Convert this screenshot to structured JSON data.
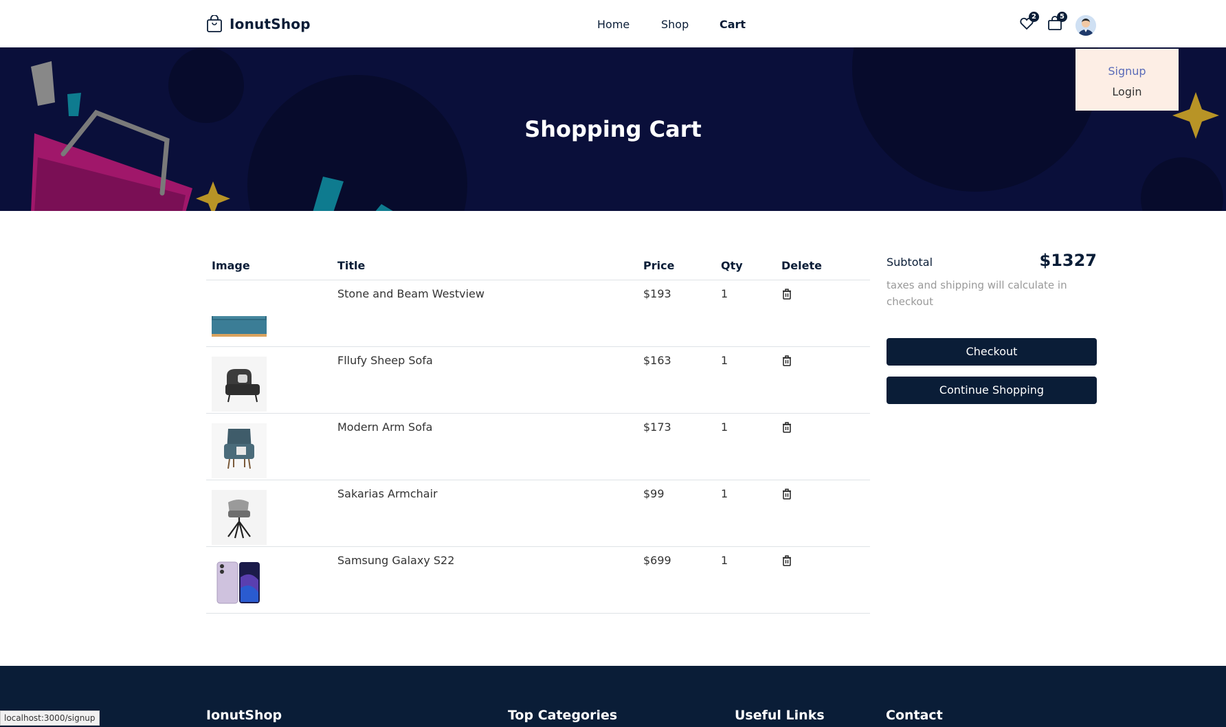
{
  "header": {
    "brand": "IonutShop",
    "nav": [
      {
        "label": "Home"
      },
      {
        "label": "Shop"
      },
      {
        "label": "Cart"
      }
    ],
    "wishlist_count": "2",
    "cart_count": "5"
  },
  "dropdown": {
    "signup": "Signup",
    "login": "Login"
  },
  "hero": {
    "title": "Shopping Cart"
  },
  "table": {
    "headers": {
      "image": "Image",
      "title": "Title",
      "price": "Price",
      "qty": "Qty",
      "delete": "Delete"
    },
    "rows": [
      {
        "title": "Stone and Beam Westview",
        "price": "$193",
        "qty": "1"
      },
      {
        "title": "Fllufy Sheep Sofa",
        "price": "$163",
        "qty": "1"
      },
      {
        "title": "Modern Arm Sofa",
        "price": "$173",
        "qty": "1"
      },
      {
        "title": "Sakarias Armchair",
        "price": "$99",
        "qty": "1"
      },
      {
        "title": "Samsung Galaxy S22",
        "price": "$699",
        "qty": "1"
      }
    ]
  },
  "summary": {
    "subtotal_label": "Subtotal",
    "subtotal_value": "$1327",
    "note": "taxes and shipping will calculate in checkout",
    "checkout": "Checkout",
    "continue": "Continue Shopping"
  },
  "footer": {
    "brand": "IonutShop",
    "top_categories": "Top Categories",
    "useful_links": "Useful Links",
    "contact": "Contact"
  },
  "status_bar": "localhost:3000/signup",
  "colors": {
    "primary": "#0a1d37",
    "hero_bg": "#0a0f3a",
    "dropdown_bg": "#fdeee5"
  }
}
